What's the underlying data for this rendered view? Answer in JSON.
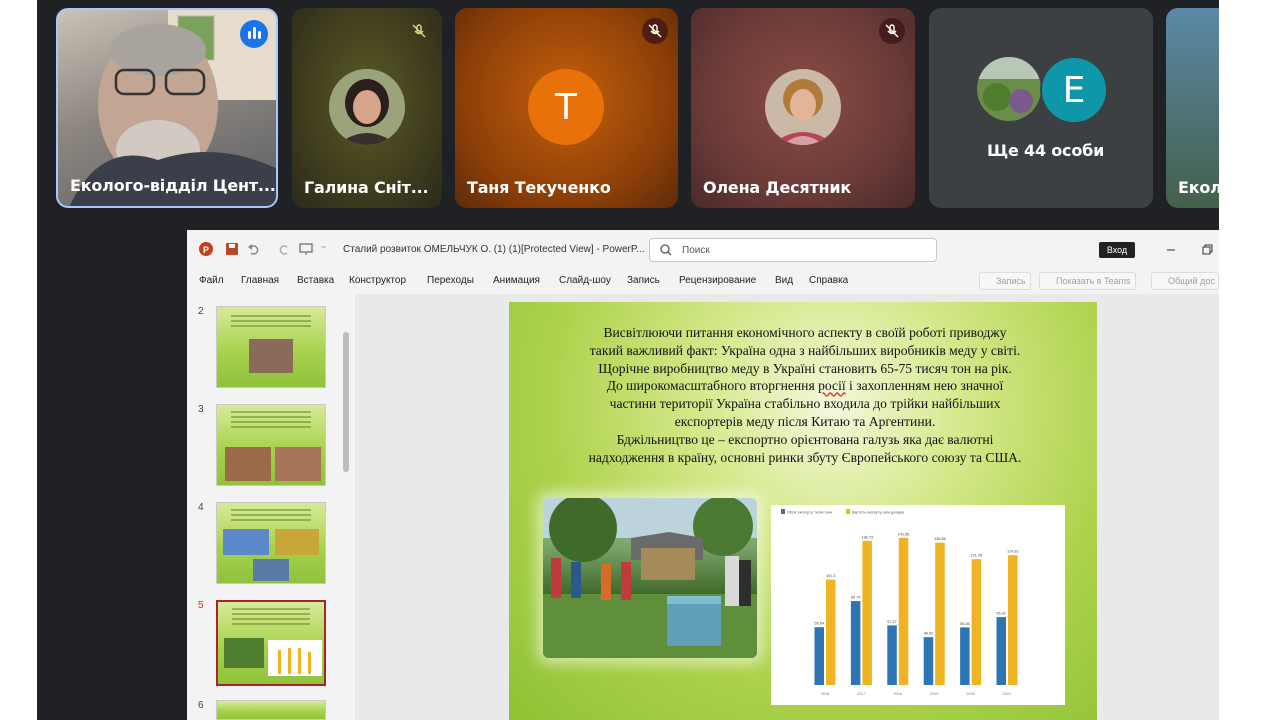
{
  "meet": {
    "tiles": [
      {
        "name": "Еколого-відділ Цент...",
        "status": "speaking"
      },
      {
        "name": "Галина Сніт...",
        "status": "muted"
      },
      {
        "name": "Таня Текученко",
        "status": "muted",
        "initial": "T",
        "color": "#e8710a"
      },
      {
        "name": "Олена Десятник",
        "status": "muted"
      },
      {
        "name": "Ще 44 особи",
        "initial": "E",
        "color": "#0e97a8"
      },
      {
        "name": "Еколо..."
      }
    ]
  },
  "ppt": {
    "doc_title": "Сталий розвиток ОМЕЛЬЧУК О. (1) (1)[Protected View]  -  PowerP...",
    "search_placeholder": "Поиск",
    "signin_label": "Вход",
    "menu": [
      "Файл",
      "Главная",
      "Вставка",
      "Конструктор",
      "Переходы",
      "Анимация",
      "Слайд-шоу",
      "Запись",
      "Рецензирование",
      "Вид",
      "Справка"
    ],
    "ribbon_buttons": [
      "Запись",
      "Показать в Teams",
      "Общий дос"
    ],
    "slide_numbers": [
      "2",
      "3",
      "4",
      "5",
      "6"
    ],
    "selected_slide": "5",
    "slide": {
      "lines": [
        "Висвітлюючи питання економічного аспекту в своїй роботі приводжу",
        "такий важливий факт: Україна одна з найбільших виробників  меду у світі.",
        "Щорічне виробництво меду в Україні становить 65-75 тисяч  тон  на рік.",
        "До широкомасштабного вторгнення ",
        "росії",
        " і захопленням нею значної",
        "частини території Україна стабільно входила до трійки найбільших",
        "експортерів меду після Китаю та Аргентини.",
        "Бджільництво це – експортно орієнтована галузь яка дає валютні",
        "надходження в країну, основні ринки збуту Європейського союзу та США."
      ]
    }
  },
  "chart_data": {
    "type": "bar",
    "legend": [
      "Обсяг експорту, тисяч тонн",
      "Вартість експорту, млн доларів"
    ],
    "legend_position": "top-left",
    "categories": [
      "2016",
      "2017",
      "2018",
      "2019",
      "2020",
      "2021"
    ],
    "series": [
      {
        "name": "Обсяг експорту, тисяч тонн",
        "values": [
          55.6,
          80.7,
          57.3,
          46.0,
          55.4,
          65.3
        ],
        "color": "#2e75b6"
      },
      {
        "name": "Вартість експорту, млн доларів",
        "values": [
          101.3,
          138.7,
          141.5,
          136.9,
          121.0,
          124.8
        ],
        "color": "#f0b323"
      }
    ],
    "data_labels_a": [
      "55.64",
      "80.73",
      "57.27",
      "46.02",
      "55.36",
      "65.31"
    ],
    "data_labels_b": [
      "101.3",
      "138.73",
      "141.56",
      "136.86",
      "121.06",
      "124.81"
    ],
    "ylim": [
      0,
      150
    ],
    "grid": false
  }
}
